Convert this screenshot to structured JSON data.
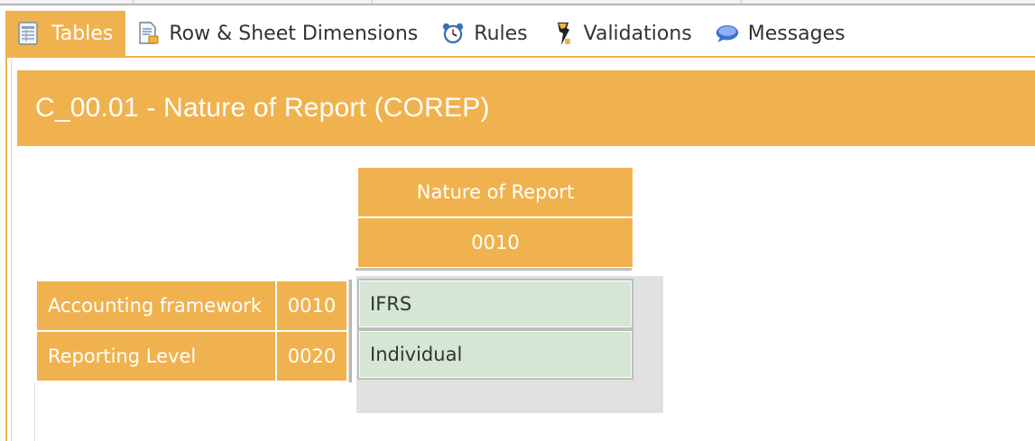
{
  "tabs": [
    {
      "label": "Tables",
      "icon": "table-icon",
      "active": true
    },
    {
      "label": "Row & Sheet Dimensions",
      "icon": "document-icon",
      "active": false
    },
    {
      "label": "Rules",
      "icon": "alarm-clock-icon",
      "active": false
    },
    {
      "label": "Validations",
      "icon": "validation-icon",
      "active": false
    },
    {
      "label": "Messages",
      "icon": "speech-bubble-icon",
      "active": false
    }
  ],
  "report": {
    "title": "C_00.01 - Nature of Report (COREP)",
    "column_header": "Nature of Report",
    "column_code": "0010",
    "rows": [
      {
        "label": "Accounting framework",
        "code": "0010",
        "value": "IFRS"
      },
      {
        "label": "Reporting Level",
        "code": "0020",
        "value": "Individual"
      }
    ]
  },
  "colors": {
    "accent": "#f0b24e",
    "cell_fill": "#d5e6d5",
    "panel": "#e0e0e0"
  }
}
